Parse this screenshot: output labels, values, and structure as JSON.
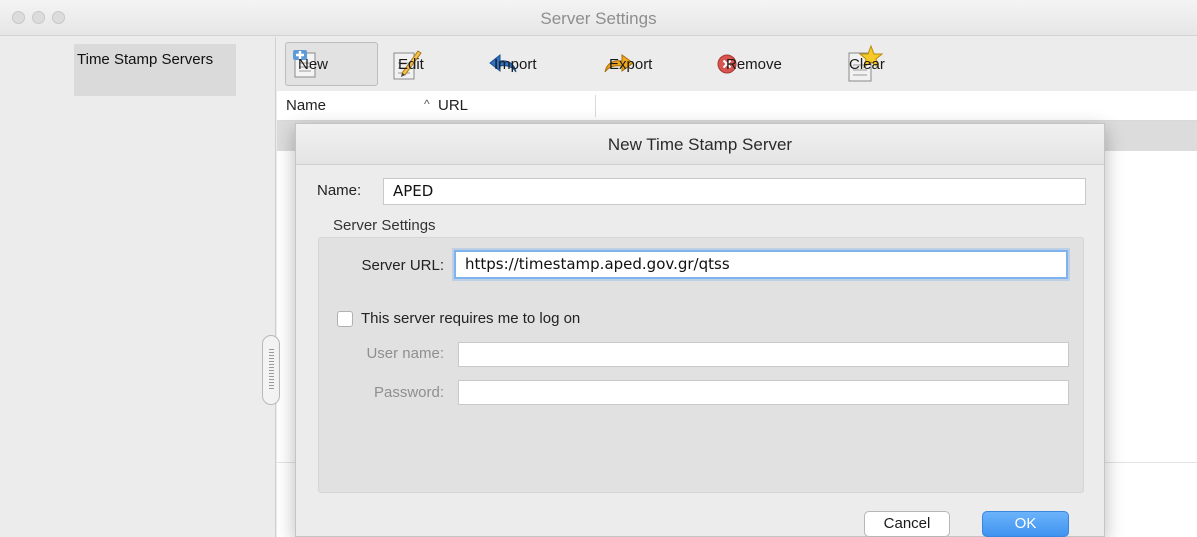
{
  "window": {
    "title": "Server Settings"
  },
  "sidebar": {
    "items": [
      {
        "label": "Time Stamp Servers"
      }
    ]
  },
  "toolbar": {
    "new_label": "New",
    "edit_label": "Edit",
    "import_label": "Import",
    "export_label": "Export",
    "remove_label": "Remove",
    "clear_label": "Clear"
  },
  "table": {
    "columns": [
      "Name",
      "URL"
    ],
    "sort_indicator": "^"
  },
  "dialog": {
    "title": "New Time Stamp Server",
    "name_label": "Name:",
    "name_value": "APED",
    "group_title": "Server Settings",
    "server_url_label": "Server URL:",
    "server_url_value": "https://timestamp.aped.gov.gr/qtss",
    "login_checkbox_label": "This server requires me to log on",
    "login_checked": false,
    "username_label": "User name:",
    "username_value": "",
    "password_label": "Password:",
    "password_value": "",
    "cancel_label": "Cancel",
    "ok_label": "OK"
  },
  "colors": {
    "accent": "#4a9cf5",
    "focus_ring": "#7eb3ee"
  },
  "icons": [
    "new-document-icon",
    "edit-pencil-icon",
    "import-arrow-icon",
    "export-arrow-icon",
    "remove-x-icon",
    "clear-star-icon"
  ]
}
